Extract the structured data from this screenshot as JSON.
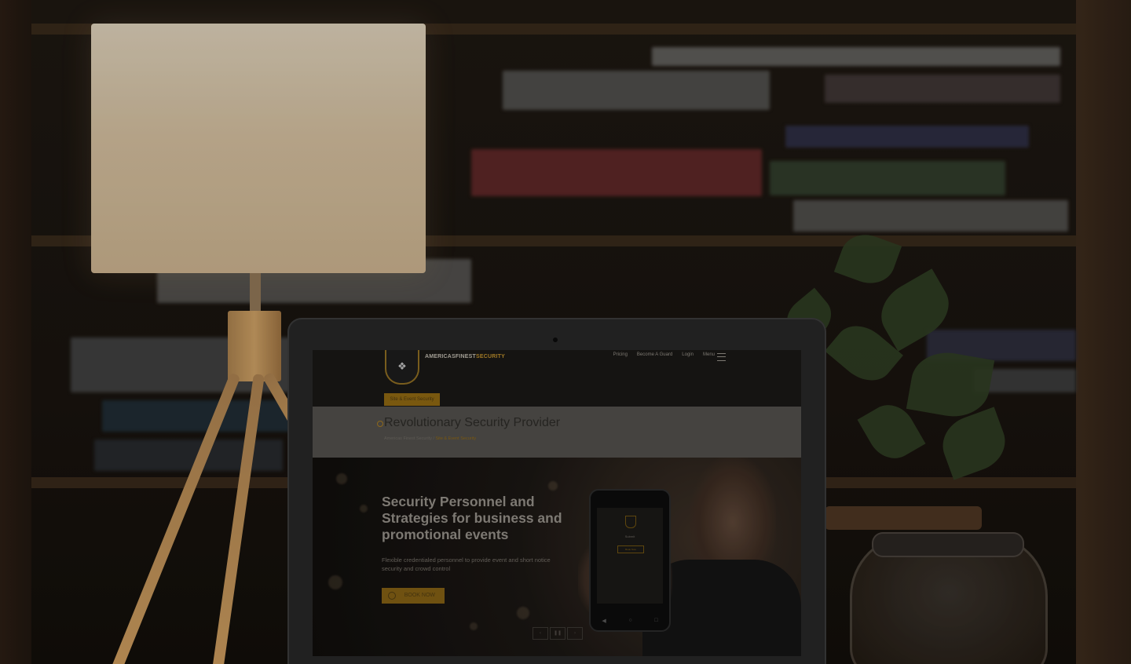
{
  "site": {
    "brand_part1": "AMERICASFINEST",
    "brand_part2": "SECURITY",
    "nav": [
      "Pricing",
      "Become A Guard",
      "Login",
      "Menu"
    ],
    "tag_button": "Site & Event Security",
    "page_title": "Revolutionary Security Provider",
    "breadcrumb_prefix": "Americas Finest Security /",
    "breadcrumb_current": "Site & Event Security",
    "hero_heading": "Security Personnel and Strategies for business and promotional events",
    "hero_text": "Flexible credentialed personnel to provide event and short notice security and crowd control",
    "book_button": "BOOK NOW",
    "phone_label": "Submit",
    "phone_button": "Book Now"
  },
  "colors": {
    "accent": "#b78a2b",
    "button_gold": "#8a6512",
    "title_band": "#4f4d49"
  },
  "icons": [
    "menu-icon",
    "logo-shield-icon",
    "book-icon",
    "phone-back-icon",
    "phone-home-icon",
    "phone-recents-icon"
  ]
}
